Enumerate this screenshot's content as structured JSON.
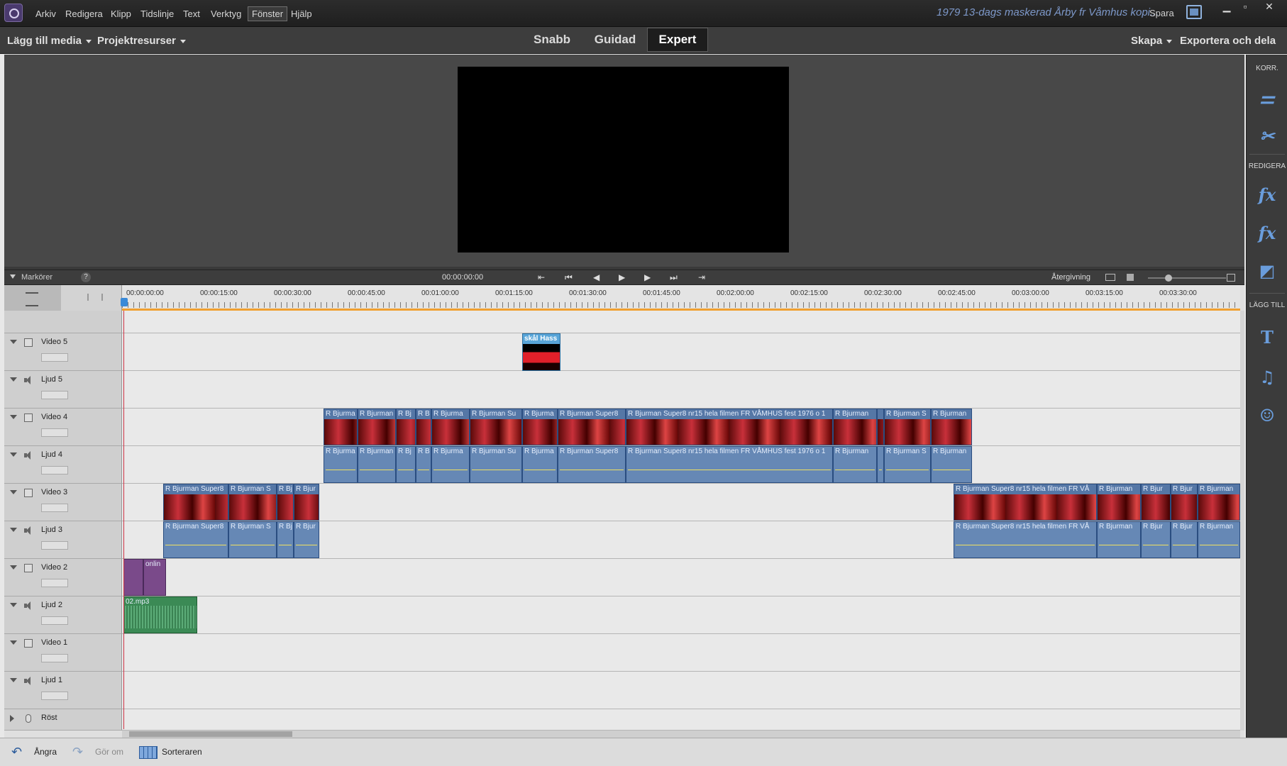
{
  "menu": [
    "Arkiv",
    "Redigera",
    "Klipp",
    "Tidslinje",
    "Text",
    "Verktyg",
    "Fönster",
    "Hjälp"
  ],
  "doc_title": "1979 13-dags maskerad Årby fr Våmhus kopi...",
  "save_label": "Spara",
  "mode_bar": {
    "add_media": "Lägg till media",
    "project_assets": "Projektresurser",
    "tabs": [
      "Snabb",
      "Guidad",
      "Expert"
    ],
    "active_tab": "Expert",
    "create": "Skapa",
    "export": "Exportera och dela"
  },
  "right_panel": {
    "korr": "KORR.",
    "redigera": "REDIGERA",
    "lagg_till": "LÄGG TILL",
    "icons": [
      "adjustments-icon",
      "tools-icon",
      "fx-edit-icon",
      "fx-icon",
      "transitions-icon",
      "titles-icon",
      "music-icon",
      "graphics-icon"
    ]
  },
  "transport": {
    "markers": "Markörer",
    "help": "?",
    "timecode": "00:00:00:00",
    "render": "Återgivning"
  },
  "ruler": {
    "labels": [
      "00:00:00:00",
      "00:00:15:00",
      "00:00:30:00",
      "00:00:45:00",
      "00:01:00:00",
      "00:01:15:00",
      "00:01:30:00",
      "00:01:45:00",
      "00:02:00:00",
      "00:02:15:00",
      "00:02:30:00",
      "00:02:45:00",
      "00:03:00:00",
      "00:03:15:00",
      "00:03:30:00"
    ]
  },
  "tracks": [
    "Video 5",
    "Ljud 5",
    "Video 4",
    "Ljud 4",
    "Video 3",
    "Ljud 3",
    "Video 2",
    "Ljud 2",
    "Video 1",
    "Ljud 1",
    "Röst"
  ],
  "clips": {
    "v5_title": "skål Hass",
    "v4": [
      "R Bjurma",
      "R Bjurman",
      "R Bj",
      "R B",
      "R Bjurma",
      "R Bjurman Su",
      "R Bjurma",
      "R Bjurman Super8",
      "R Bjurman Super8 nr15 hela filmen FR VÅMHUS fest 1976 o 1",
      "R Bjurman",
      "",
      "R Bjurman S",
      "R Bjurman"
    ],
    "v3_left": [
      "R Bjurman Super8",
      "R Bjurman S",
      "R Bj",
      "R Bjur"
    ],
    "v3_right": [
      "R Bjurman Super8 nr15 hela filmen FR VÅ",
      "R Bjurman",
      "R Bjur",
      "R Bjur",
      "R Bjurman"
    ],
    "v2": "onlin",
    "a2": "02.mp3"
  },
  "footer": {
    "undo": "Ångra",
    "redo": "Gör om",
    "sorter": "Sorteraren"
  }
}
